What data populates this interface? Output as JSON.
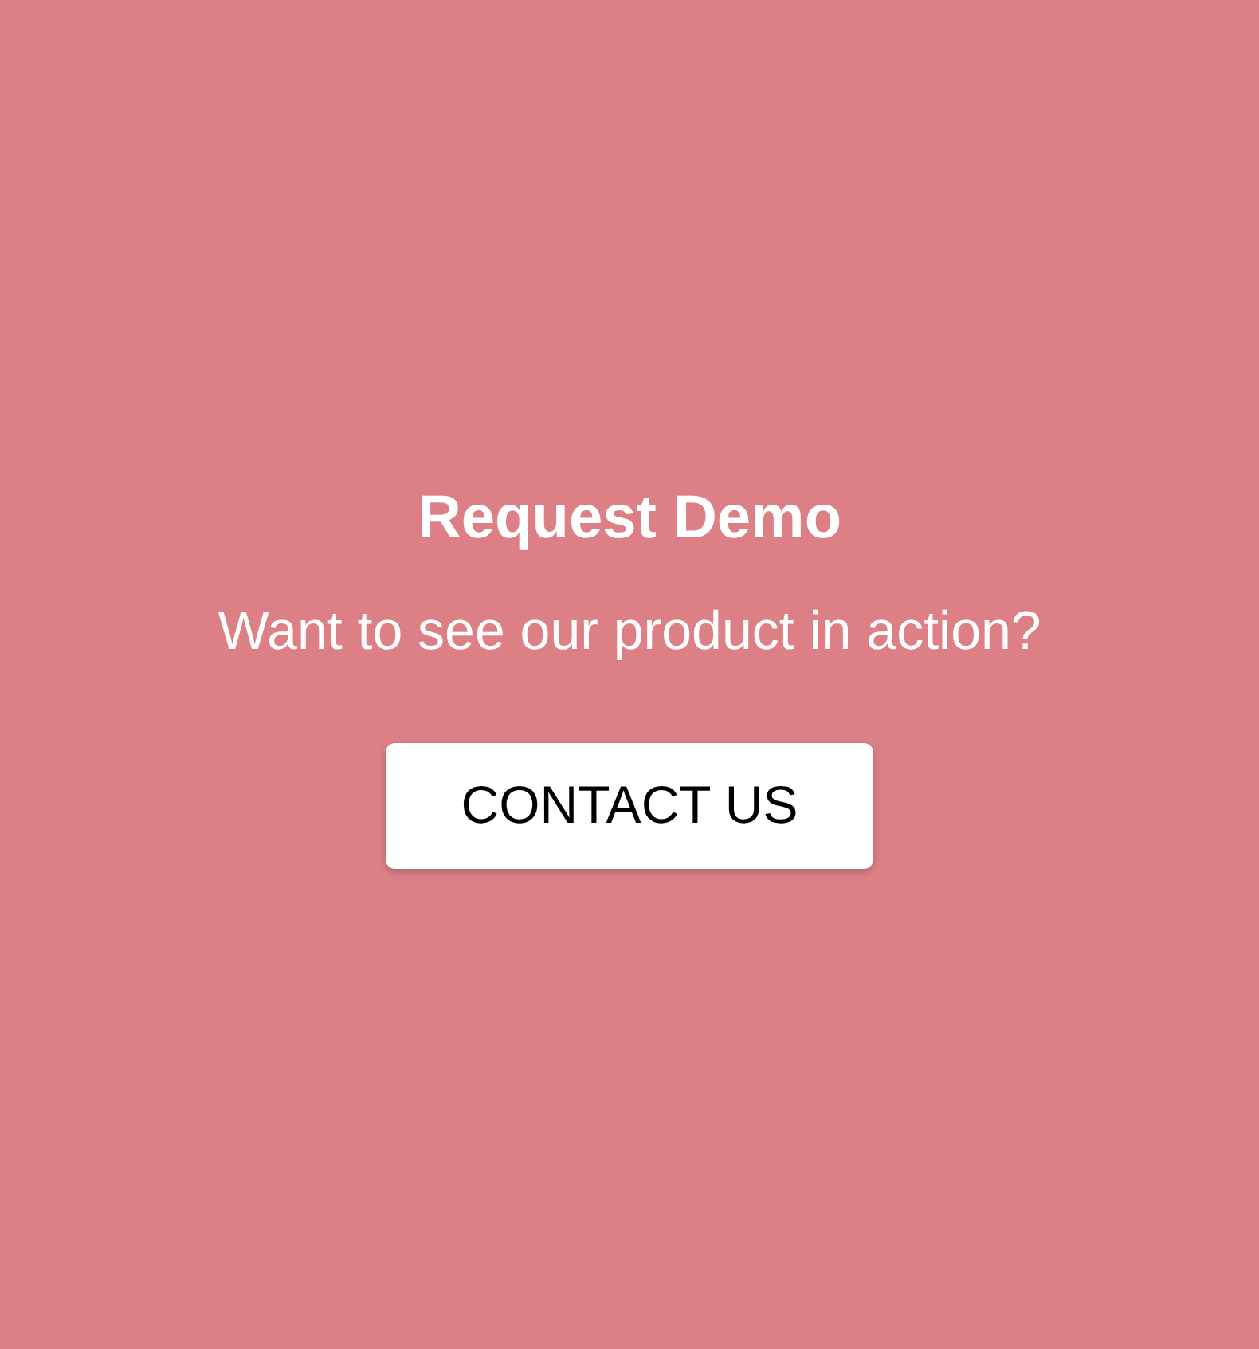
{
  "title": "Request Demo",
  "subtitle": "Want to see our product in action?",
  "button": {
    "label": "CONTACT US"
  }
}
